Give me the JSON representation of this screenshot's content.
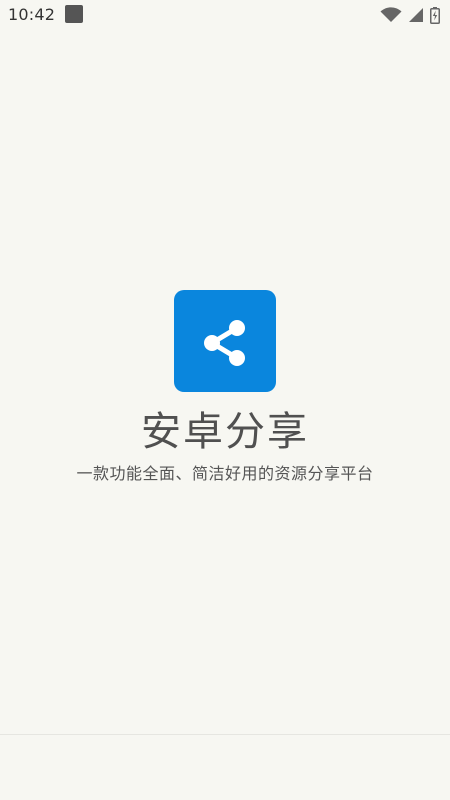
{
  "status_bar": {
    "time": "10:42",
    "icons": [
      "notification-square-icon",
      "wifi-icon",
      "cell-signal-icon",
      "battery-charging-icon"
    ]
  },
  "splash": {
    "app_icon": "share-icon",
    "title": "安卓分享",
    "subtitle": "一款功能全面、简洁好用的资源分享平台"
  },
  "colors": {
    "background": "#f7f7f2",
    "icon_bg": "#0a86dd",
    "title_text": "#505050",
    "subtitle_text": "#555555"
  }
}
